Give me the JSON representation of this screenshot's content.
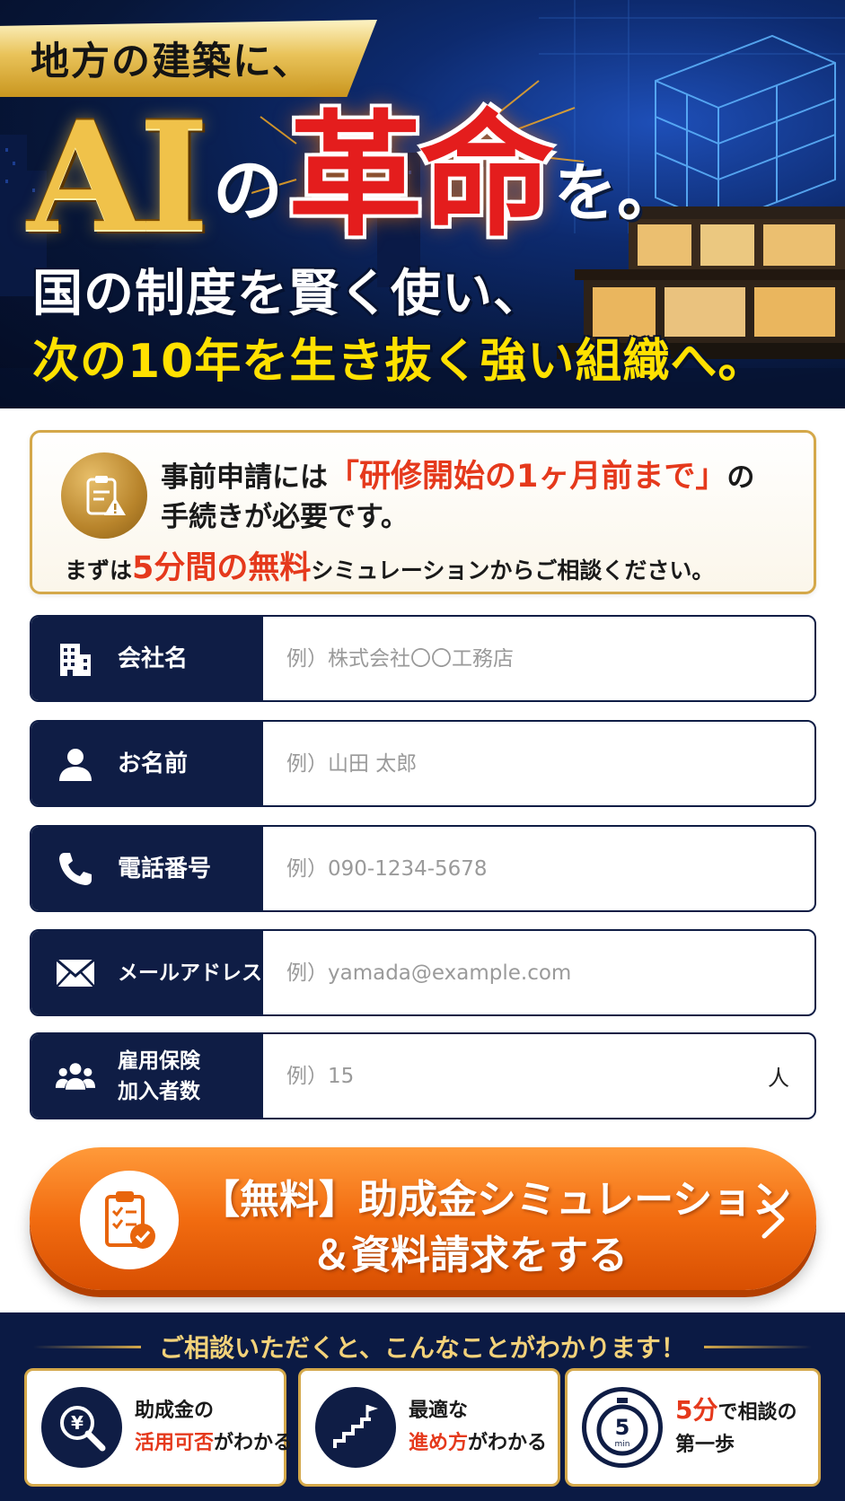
{
  "hero": {
    "ribbon": "地方の建築に、",
    "ai": "AI",
    "no": "の",
    "kakumei": "革命",
    "wo": "を。",
    "lead1": "国の制度を賢く使い、",
    "lead2": "次の10年を生き抜く強い組織へ。"
  },
  "notice": {
    "l1_pre": "事前申請には",
    "l1_red": "「研修開始の1ヶ月前まで」",
    "l1_post": "の",
    "l2": "手続きが必要です。",
    "l3_pre": "まずは",
    "l3_red": "5分間の無料",
    "l3_post": "シミュレーションからご相談ください。"
  },
  "form": {
    "company": {
      "label": "会社名",
      "placeholder": "例）株式会社〇〇工務店",
      "value": ""
    },
    "name": {
      "label": "お名前",
      "placeholder": "例）山田 太郎",
      "value": ""
    },
    "phone": {
      "label": "電話番号",
      "placeholder": "例）090-1234-5678",
      "value": ""
    },
    "email": {
      "label": "メールアドレス",
      "placeholder": "例）yamada@example.com",
      "value": ""
    },
    "employees": {
      "label_l1": "雇用保険",
      "label_l2": "加入者数",
      "placeholder": "例）15",
      "unit": "人",
      "value": ""
    }
  },
  "cta": {
    "line1": "【無料】助成金シミュレーション",
    "line2": "＆資料請求をする"
  },
  "benefits": {
    "title": "ご相談いただくと、こんなことがわかります！",
    "cards": [
      {
        "l1": "助成金の",
        "l2_red": "活用可否",
        "l2_post": "がわかる",
        "icon": "yen-magnifier-icon"
      },
      {
        "l1": "最適な",
        "l2_red": "進め方",
        "l2_post": "がわかる",
        "icon": "stairs-flag-icon"
      },
      {
        "l1_red": "5分",
        "l1_post": "で相談の",
        "l2": "第一歩",
        "timer_num": "5",
        "timer_unit": "min",
        "icon": "stopwatch-icon"
      }
    ]
  },
  "colors": {
    "navy": "#0f1d45",
    "gold": "#d4a84a",
    "accent_red": "#e5391c",
    "cta_orange": "#f26c10",
    "headline_yellow": "#ffe100"
  }
}
